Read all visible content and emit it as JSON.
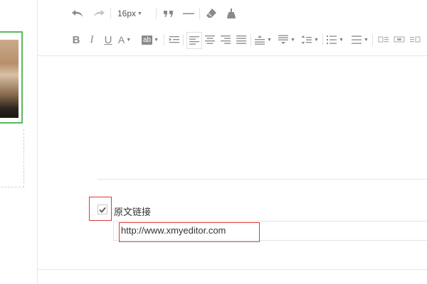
{
  "toolbar": {
    "font_size": "16px",
    "row1_icons": [
      "undo-icon",
      "redo-icon",
      "font-size-dropdown",
      "blockquote-icon",
      "horizontal-rule-icon",
      "clear-format-icon",
      "format-painter-icon"
    ],
    "row2_icons": [
      "bold-icon",
      "italic-icon",
      "underline-icon",
      "font-color-icon",
      "background-color-icon",
      "indent-icon",
      "align-left-icon",
      "align-center-icon",
      "align-right-icon",
      "align-justify-icon",
      "row-spacing-top-icon",
      "row-spacing-bottom-icon",
      "line-height-icon",
      "ordered-list-icon",
      "unordered-list-icon",
      "image-left-icon",
      "image-center-icon",
      "image-right-icon"
    ],
    "labels": {
      "bold": "B",
      "italic": "I",
      "underline": "U",
      "font_color": "A",
      "background_color": "ab"
    }
  },
  "original_link": {
    "label": "原文链接",
    "checked": true,
    "url": "http://www.xmyeditor.com"
  },
  "colors": {
    "highlight": "#d93a3a",
    "thumb_border": "#5cb85c",
    "icon": "#8a8a8a"
  }
}
